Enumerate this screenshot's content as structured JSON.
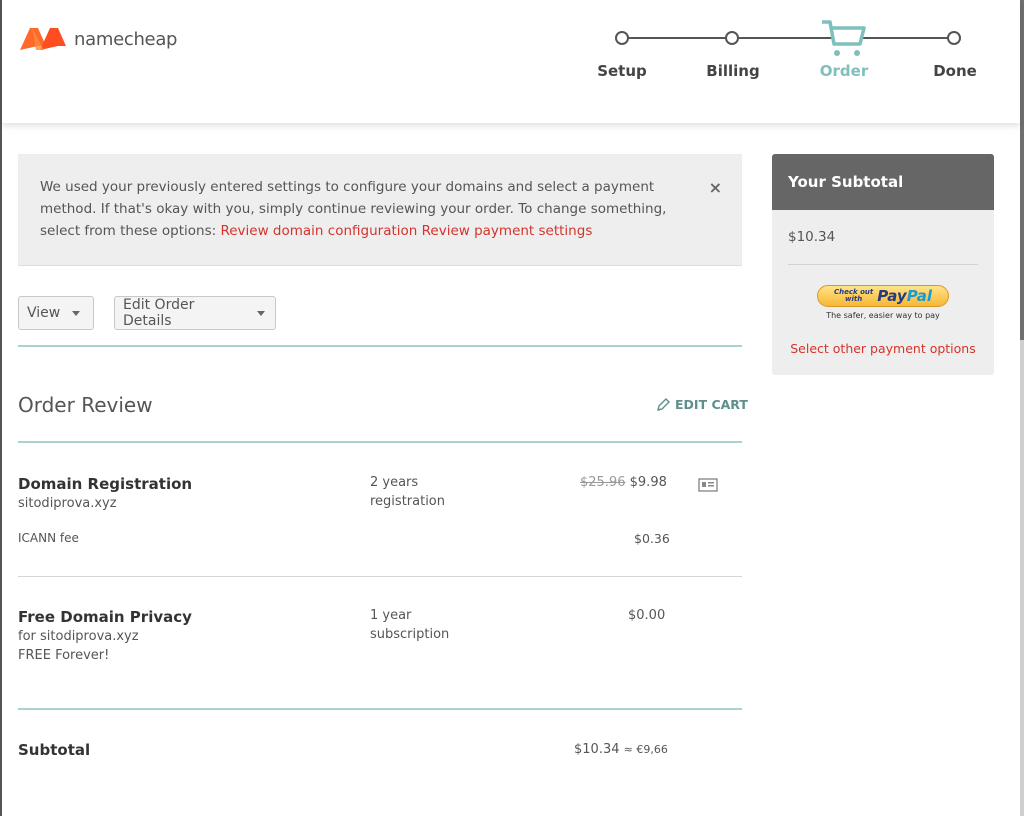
{
  "brand": {
    "name": "namecheap",
    "accent": "#ff5a2c"
  },
  "steps": [
    {
      "label": "Setup",
      "active": false
    },
    {
      "label": "Billing",
      "active": false
    },
    {
      "label": "Order",
      "active": true
    },
    {
      "label": "Done",
      "active": false
    }
  ],
  "notice": {
    "text": "We used your previously entered settings to configure your domains and select a payment method. If that's okay with you, simply continue reviewing your order. To change something, select from these options:",
    "link1": "Review domain configuration",
    "link2": "Review payment settings",
    "close": "×"
  },
  "toolbar": {
    "view_label": "View",
    "edit_label": "Edit Order Details"
  },
  "review": {
    "title": "Order Review",
    "edit_cart": "EDIT CART",
    "items": [
      {
        "title": "Domain Registration",
        "domain": "sitodiprova.xyz",
        "period_line1": "2 years",
        "period_line2": "registration",
        "old_price": "$25.96",
        "price": "$9.98",
        "fee_label": "ICANN fee",
        "fee_price": "$0.36"
      },
      {
        "title": "Free Domain Privacy",
        "domain": "for sitodiprova.xyz",
        "note": "FREE Forever!",
        "period_line1": "1 year",
        "period_line2": "subscription",
        "price": "$0.00"
      }
    ],
    "subtotal_label": "Subtotal",
    "subtotal_value": "$10.34",
    "subtotal_converted": "≈ €9,66"
  },
  "sidebar": {
    "title": "Your Subtotal",
    "amount": "$10.34",
    "paypal_small1": "Check out",
    "paypal_small2": "with",
    "paypal_brand1": "Pay",
    "paypal_brand2": "Pal",
    "paypal_tag": "The safer, easier way to pay",
    "other_payments": "Select other payment options"
  }
}
